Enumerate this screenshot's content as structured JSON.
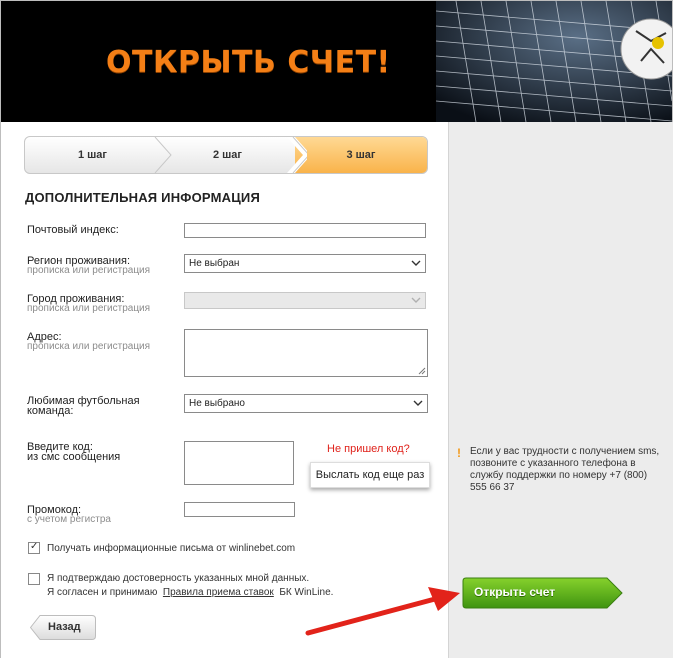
{
  "banner": {
    "title": "ОТКРЫТЬ СЧЕТ!"
  },
  "steps": [
    {
      "label": "1 шаг",
      "active": false
    },
    {
      "label": "2 шаг",
      "active": false
    },
    {
      "label": "3 шаг",
      "active": true
    }
  ],
  "form": {
    "title": "ДОПОЛНИТЕЛЬНАЯ ИНФОРМАЦИЯ",
    "postal": {
      "label": "Почтовый индекс:",
      "value": ""
    },
    "region": {
      "label": "Регион проживания:",
      "hint": "прописка или регистрация",
      "selected": "Не выбран"
    },
    "city": {
      "label": "Город проживания:",
      "hint": "прописка или регистрация",
      "selected": ""
    },
    "address": {
      "label": "Адрес:",
      "hint": "прописка или регистрация",
      "value": ""
    },
    "team": {
      "label_line1": "Любимая футбольная",
      "label_line2": "команда:",
      "selected": "Не выбрано"
    },
    "code": {
      "label_line1": "Введите код:",
      "label_line2": "из смс сообщения",
      "not_received": "Не пришел код?",
      "resend": "Выслать код еще раз"
    },
    "promo": {
      "label": "Промокод:",
      "hint": "с учетом регистра"
    },
    "newsletter": {
      "checked": true,
      "text": "Получать информационные письма от winlinebet.com"
    },
    "confirm": {
      "checked": false,
      "line1": "Я подтверждаю достоверность указанных мной данных.",
      "line2_prefix": "Я согласен и принимаю",
      "rules_link": "Правила приема ставок",
      "line2_suffix": "БК WinLine."
    }
  },
  "back_button": "Назад",
  "help": {
    "icon": "!",
    "text": "Если у вас трудности с получением sms, позвоните с указанного телефона в службу поддержки по номеру +7 (800) 555 66 37"
  },
  "submit_button": "Открыть счет",
  "colors": {
    "accent_orange": "#f47f16",
    "active_step": "#f9b34a",
    "submit_green": "#5cb018",
    "error_red": "#e0231c",
    "arrow_red": "#e2231a"
  }
}
